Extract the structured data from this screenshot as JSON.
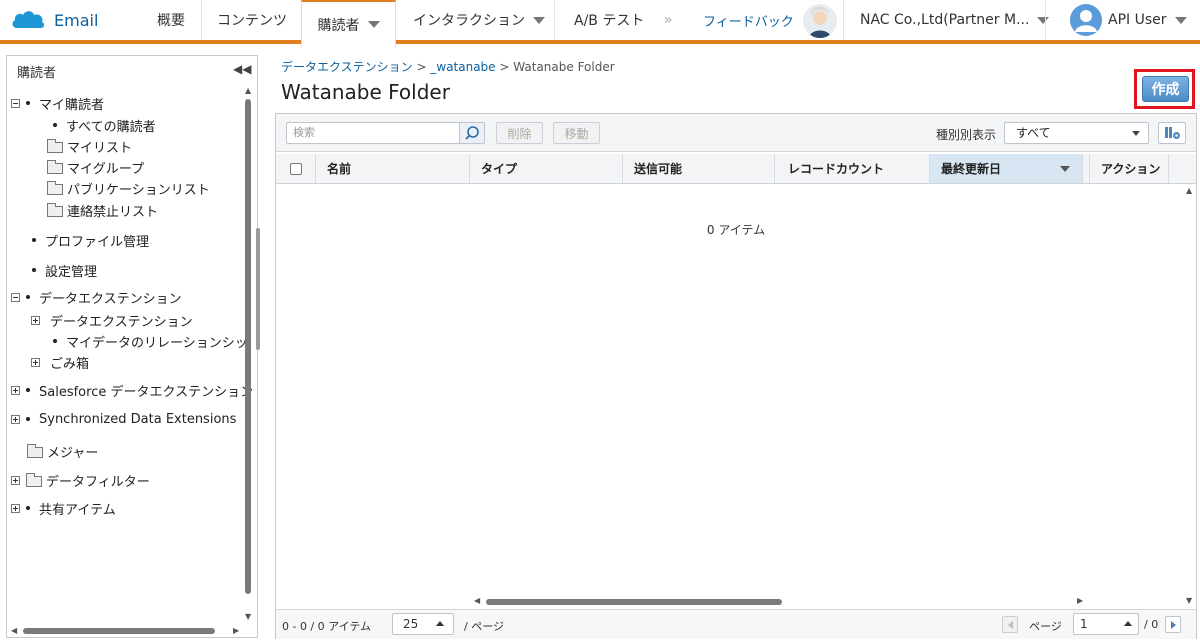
{
  "nav": {
    "brand": "Email",
    "items": [
      "概要",
      "コンテンツ",
      "購読者",
      "インタラクション",
      "A/B テスト"
    ],
    "overflow_glyph": "»",
    "feedback": "フィードバック",
    "account": "NAC Co.,Ltd(Partner M...",
    "user": "API User",
    "accent_color": "#e17f1d"
  },
  "left_pane": {
    "title": "購読者",
    "collapse_glyph": "◀◀",
    "tree": [
      {
        "label": "マイ購読者"
      },
      {
        "label": "すべての購読者"
      },
      {
        "label": "マイリスト"
      },
      {
        "label": "マイグループ"
      },
      {
        "label": "パブリケーションリスト"
      },
      {
        "label": "連絡禁止リスト"
      },
      {
        "label": "プロファイル管理"
      },
      {
        "label": "設定管理"
      },
      {
        "label": "データエクステンション"
      },
      {
        "label": "データエクステンション"
      },
      {
        "label": "マイデータのリレーションシッ"
      },
      {
        "label": "ごみ箱"
      },
      {
        "label": "Salesforce データエクステンション"
      },
      {
        "label": "Synchronized Data Extensions"
      },
      {
        "label": "メジャー"
      },
      {
        "label": "データフィルター"
      },
      {
        "label": "共有アイテム"
      }
    ]
  },
  "breadcrumb": {
    "items": [
      "データエクステンション",
      "_watanabe",
      "Watanabe Folder"
    ],
    "separator": ">"
  },
  "page_title": "Watanabe Folder",
  "create_button": "作成",
  "toolbar": {
    "search_placeholder": "検索",
    "delete": "削除",
    "move": "移動",
    "filter_label": "種別別表示",
    "filter_value": "すべて"
  },
  "table": {
    "columns": [
      "名前",
      "タイプ",
      "送信可能",
      "レコードカウント",
      "最終更新日",
      "アクション"
    ],
    "sorted_column": "最終更新日",
    "rows": [],
    "empty_message": "0 アイテム"
  },
  "footer": {
    "count": "0 - 0 / 0 アイテム",
    "page_size": "25",
    "per_page": "/ ページ",
    "page_label": "ページ",
    "page_value": "1",
    "total_pages": "/ 0"
  }
}
